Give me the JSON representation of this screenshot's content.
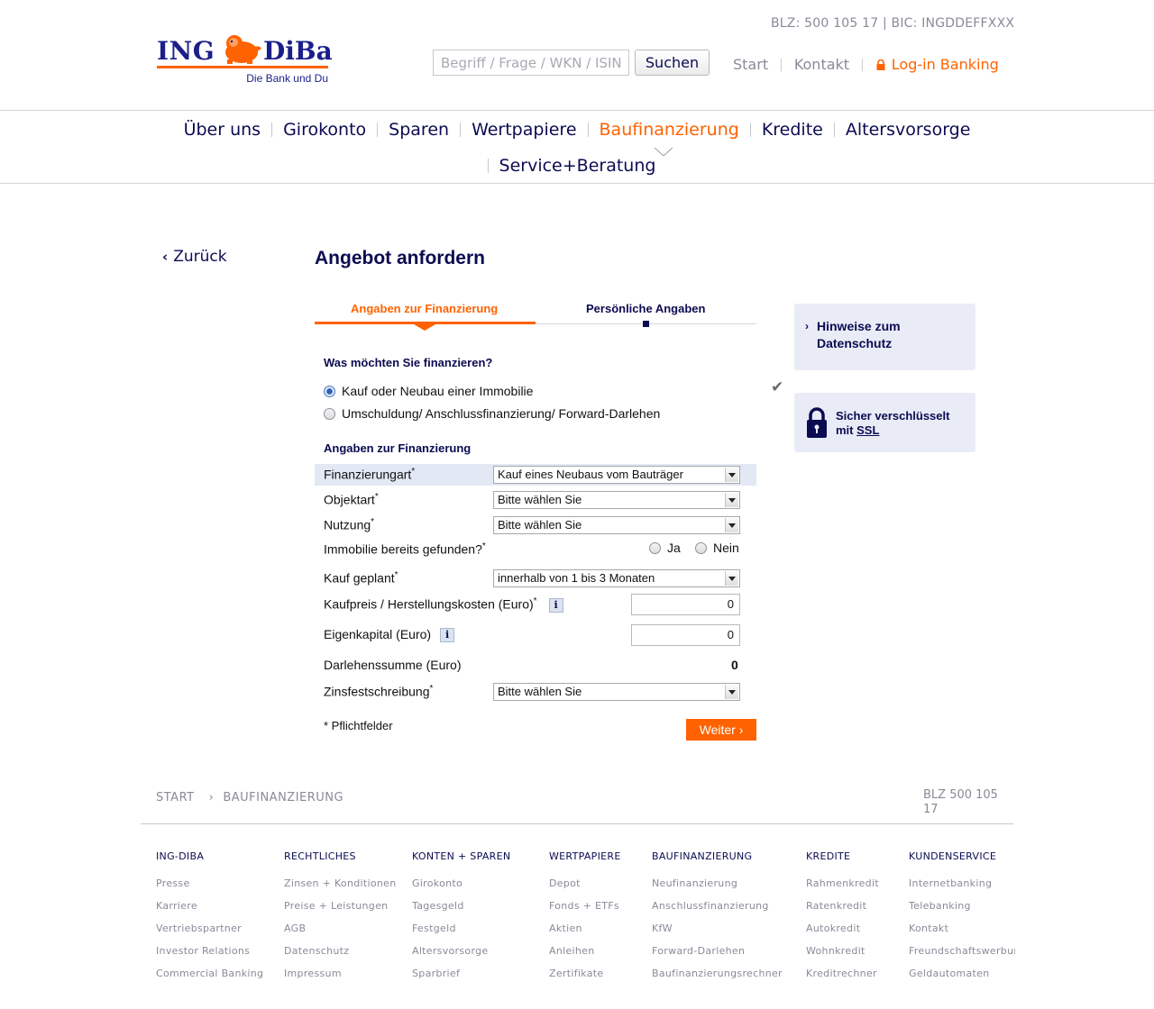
{
  "header": {
    "blz_bic": "BLZ: 500 105 17 | BIC: INGDDEFFXXX",
    "logo": {
      "left": "ING",
      "right": "DiBa",
      "tagline": "Die Bank und Du"
    },
    "search_placeholder": "Begriff / Frage / WKN / ISIN",
    "search_button": "Suchen",
    "links": {
      "start": "Start",
      "kontakt": "Kontakt",
      "login": "Log-in Banking"
    }
  },
  "nav": {
    "items": [
      "Über uns",
      "Girokonto",
      "Sparen",
      "Wertpapiere",
      "Baufinanzierung",
      "Kredite",
      "Altersvorsorge",
      "Service+Beratung"
    ],
    "active": "Baufinanzierung"
  },
  "back": "Zurück",
  "title": "Angebot anfordern",
  "steps": {
    "step1": "Angaben zur Finanzierung",
    "step2": "Persönliche Angaben"
  },
  "form": {
    "question": "Was möchten Sie finanzieren?",
    "radio1": "Kauf oder Neubau einer Immobilie",
    "radio2": "Umschuldung/ Anschlussfinanzierung/ Forward-Darlehen",
    "section": "Angaben zur Finanzierung",
    "finanzierungsart_label": "Finanzierungart",
    "finanzierungsart_value": "Kauf eines Neubaus vom Bauträger",
    "objektart_label": "Objektart",
    "objektart_value": "Bitte wählen Sie",
    "nutzung_label": "Nutzung",
    "nutzung_value": "Bitte wählen Sie",
    "gefunden_label": "Immobilie bereits gefunden?",
    "ja": "Ja",
    "nein": "Nein",
    "kauf_label": "Kauf geplant",
    "kauf_value": "innerhalb von 1 bis 3 Monaten",
    "kaufpreis_label": "Kaufpreis / Herstellungskosten (Euro)",
    "kaufpreis_value": "0",
    "eigenkapital_label": "Eigenkapital (Euro)",
    "eigenkapital_value": "0",
    "darlehen_label": "Darlehenssumme (Euro)",
    "darlehen_value": "0",
    "zins_label": "Zinsfestschreibung",
    "zins_value": "Bitte wählen Sie",
    "star": "*",
    "info": "i",
    "pflicht": "* Pflichtfelder",
    "weiter": "Weiter"
  },
  "sidebar": {
    "datenschutz": "Hinweise zum Datenschutz",
    "ssl_line1": "Sicher verschlüsselt",
    "ssl_mit": "mit",
    "ssl_link": "SSL"
  },
  "footer": {
    "crumb1": "START",
    "crumb2": "BAUFINANZIERUNG",
    "blz": "BLZ 500 105 17",
    "columns": [
      {
        "h": "ING-DIBA",
        "links": [
          "Presse",
          "Karriere",
          "Vertriebspartner",
          "Investor Relations",
          "Commercial Banking"
        ]
      },
      {
        "h": "RECHTLICHES",
        "links": [
          "Zinsen + Konditionen",
          "Preise + Leistungen",
          "AGB",
          "Datenschutz",
          "Impressum"
        ]
      },
      {
        "h": "KONTEN + SPAREN",
        "links": [
          "Girokonto",
          "Tagesgeld",
          "Festgeld",
          "Altersvorsorge",
          "Sparbrief"
        ]
      },
      {
        "h": "WERTPAPIERE",
        "links": [
          "Depot",
          "Fonds + ETFs",
          "Aktien",
          "Anleihen",
          "Zertifikate"
        ]
      },
      {
        "h": "BAUFINANZIERUNG",
        "links": [
          "Neufinanzierung",
          "Anschlussfinanzierung",
          "KfW",
          "Forward-Darlehen",
          "Baufinanzierungsrechner"
        ]
      },
      {
        "h": "KREDITE",
        "links": [
          "Rahmenkredit",
          "Ratenkredit",
          "Autokredit",
          "Wohnkredit",
          "Kreditrechner"
        ]
      },
      {
        "h": "KUNDENSERVICE",
        "links": [
          "Internetbanking",
          "Telebanking",
          "Kontakt",
          "Freundschaftswerbung",
          "Geldautomaten"
        ]
      }
    ]
  },
  "colors": {
    "brand_orange": "#ff6200",
    "brand_blue": "#0b0b52"
  }
}
